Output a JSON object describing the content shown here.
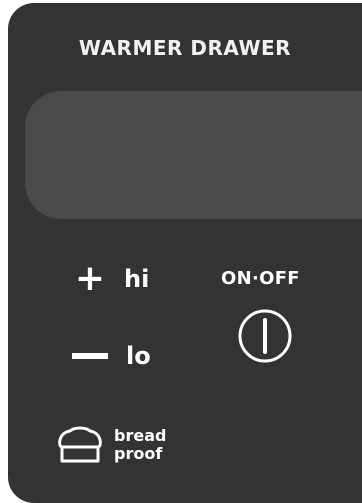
{
  "panel": {
    "title": "WARMER DRAWER",
    "display_value": ""
  },
  "controls": {
    "hi": {
      "symbol": "+",
      "label": "hi"
    },
    "lo": {
      "symbol": "−",
      "label": "lo"
    },
    "bread_proof": {
      "line1": "bread",
      "line2": "proof",
      "icon": "bread-loaf-icon"
    },
    "power": {
      "label": "ON·OFF",
      "icon": "power-icon"
    }
  },
  "colors": {
    "panel": "#333333",
    "display": "#4a4a4a",
    "text": "#ffffff"
  }
}
